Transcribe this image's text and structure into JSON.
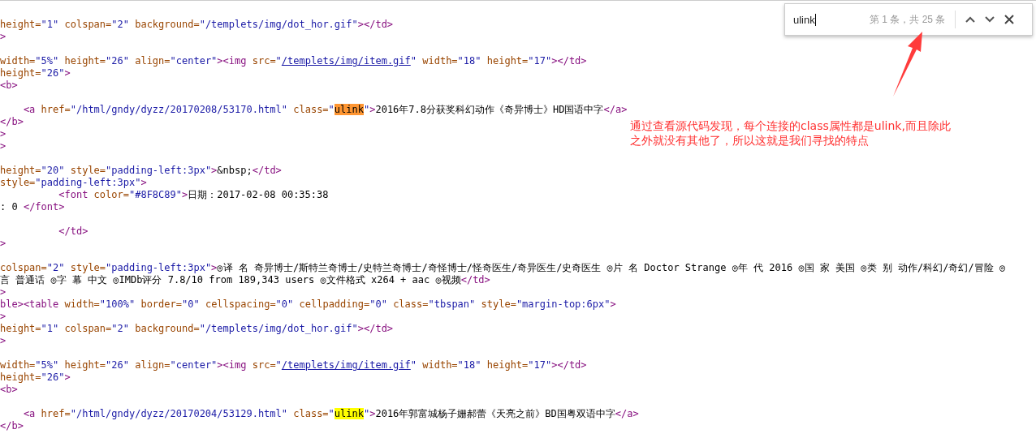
{
  "source_lines": [
    {
      "kind": "code",
      "segments": [
        {
          "kind": "attr",
          "text": "height="
        },
        {
          "kind": "value",
          "text": "\"1\" "
        },
        {
          "kind": "attr",
          "text": "colspan="
        },
        {
          "kind": "value",
          "text": "\"2\" "
        },
        {
          "kind": "attr",
          "text": "background="
        },
        {
          "kind": "value",
          "text": "\"/templets/img/dot_hor.gif\""
        },
        {
          "kind": "tag",
          "text": "></td>"
        }
      ]
    },
    {
      "kind": "code",
      "segments": [
        {
          "kind": "tag",
          "text": ">"
        }
      ]
    },
    {
      "kind": "blank"
    },
    {
      "kind": "code",
      "segments": [
        {
          "kind": "attr",
          "text": "width="
        },
        {
          "kind": "value",
          "text": "\"5%\" "
        },
        {
          "kind": "attr",
          "text": "height="
        },
        {
          "kind": "value",
          "text": "\"26\" "
        },
        {
          "kind": "attr",
          "text": "align="
        },
        {
          "kind": "value",
          "text": "\"center\""
        },
        {
          "kind": "tag",
          "text": "><img "
        },
        {
          "kind": "attr",
          "text": "src="
        },
        {
          "kind": "value",
          "text": "\""
        },
        {
          "kind": "link",
          "text": "/templets/img/item.gif"
        },
        {
          "kind": "value",
          "text": "\" "
        },
        {
          "kind": "attr",
          "text": "width="
        },
        {
          "kind": "value",
          "text": "\"18\" "
        },
        {
          "kind": "attr",
          "text": "height="
        },
        {
          "kind": "value",
          "text": "\"17\""
        },
        {
          "kind": "tag",
          "text": "></td>"
        }
      ]
    },
    {
      "kind": "code",
      "segments": [
        {
          "kind": "attr",
          "text": "height="
        },
        {
          "kind": "value",
          "text": "\"26\""
        },
        {
          "kind": "tag",
          "text": ">"
        }
      ]
    },
    {
      "kind": "code",
      "segments": [
        {
          "kind": "tag",
          "text": "<b>"
        }
      ]
    },
    {
      "kind": "blank"
    },
    {
      "kind": "code",
      "segments": [
        {
          "kind": "tag",
          "text": "    <a "
        },
        {
          "kind": "attr",
          "text": "href="
        },
        {
          "kind": "value",
          "text": "\"/html/gndy/dyzz/20170208/53170.html\" "
        },
        {
          "kind": "attr",
          "text": "class="
        },
        {
          "kind": "value",
          "text": "\""
        },
        {
          "kind": "match",
          "text": "ulink",
          "selected": true
        },
        {
          "kind": "value",
          "text": "\""
        },
        {
          "kind": "tag",
          "text": ">"
        },
        {
          "kind": "text",
          "text": "2016年7.8分获奖科幻动作《奇异博士》HD国语中字"
        },
        {
          "kind": "tag",
          "text": "</a>"
        }
      ]
    },
    {
      "kind": "code",
      "segments": [
        {
          "kind": "tag",
          "text": "</b>"
        }
      ]
    },
    {
      "kind": "code",
      "segments": [
        {
          "kind": "tag",
          "text": ">"
        }
      ]
    },
    {
      "kind": "code",
      "segments": [
        {
          "kind": "tag",
          "text": ">"
        }
      ]
    },
    {
      "kind": "blank"
    },
    {
      "kind": "code",
      "segments": [
        {
          "kind": "attr",
          "text": "height="
        },
        {
          "kind": "value",
          "text": "\"20\" "
        },
        {
          "kind": "attr",
          "text": "style="
        },
        {
          "kind": "value",
          "text": "\"padding-left:3px\""
        },
        {
          "kind": "tag",
          "text": ">"
        },
        {
          "kind": "text",
          "text": "&nbsp;"
        },
        {
          "kind": "tag",
          "text": "</td>"
        }
      ]
    },
    {
      "kind": "code",
      "segments": [
        {
          "kind": "attr",
          "text": "style="
        },
        {
          "kind": "value",
          "text": "\"padding-left:3px\""
        },
        {
          "kind": "tag",
          "text": ">"
        }
      ]
    },
    {
      "kind": "code",
      "segments": [
        {
          "kind": "tag",
          "text": "          <font "
        },
        {
          "kind": "attr",
          "text": "color="
        },
        {
          "kind": "value",
          "text": "\"#8F8C89\""
        },
        {
          "kind": "tag",
          "text": ">"
        },
        {
          "kind": "text",
          "text": "日期：2017-02-08 00:35:38"
        }
      ]
    },
    {
      "kind": "code",
      "segments": [
        {
          "kind": "text",
          "text": ": 0 "
        },
        {
          "kind": "tag",
          "text": "</font>"
        }
      ]
    },
    {
      "kind": "blank"
    },
    {
      "kind": "code",
      "segments": [
        {
          "kind": "tag",
          "text": "          </td>"
        }
      ]
    },
    {
      "kind": "code",
      "segments": [
        {
          "kind": "tag",
          "text": ">"
        }
      ]
    },
    {
      "kind": "blank"
    },
    {
      "kind": "code",
      "segments": [
        {
          "kind": "attr",
          "text": "colspan="
        },
        {
          "kind": "value",
          "text": "\"2\" "
        },
        {
          "kind": "attr",
          "text": "style="
        },
        {
          "kind": "value",
          "text": "\"padding-left:3px\""
        },
        {
          "kind": "tag",
          "text": ">"
        },
        {
          "kind": "text",
          "text": "◎译 名 奇异博士/斯特兰奇博士/史特兰奇博士/奇怪博士/怪奇医生/奇异医生/史奇医生 ◎片 名 Doctor Strange ◎年 代 2016 ◎国 家 美国 ◎类 别 动作/科幻/奇幻/冒险 ◎"
        }
      ]
    },
    {
      "kind": "code",
      "segments": [
        {
          "kind": "text",
          "text": "言 普通话 ◎字 幕 中文 ◎IMDb评分 7.8/10 from 189,343 users ◎文件格式 x264 + aac ◎视频"
        },
        {
          "kind": "tag",
          "text": "</td>"
        }
      ]
    },
    {
      "kind": "code",
      "segments": [
        {
          "kind": "tag",
          "text": ">"
        }
      ]
    },
    {
      "kind": "code",
      "segments": [
        {
          "kind": "tag",
          "text": "ble><table "
        },
        {
          "kind": "attr",
          "text": "width="
        },
        {
          "kind": "value",
          "text": "\"100%\" "
        },
        {
          "kind": "attr",
          "text": "border="
        },
        {
          "kind": "value",
          "text": "\"0\" "
        },
        {
          "kind": "attr",
          "text": "cellspacing="
        },
        {
          "kind": "value",
          "text": "\"0\" "
        },
        {
          "kind": "attr",
          "text": "cellpadding="
        },
        {
          "kind": "value",
          "text": "\"0\" "
        },
        {
          "kind": "attr",
          "text": "class="
        },
        {
          "kind": "value",
          "text": "\"tbspan\" "
        },
        {
          "kind": "attr",
          "text": "style="
        },
        {
          "kind": "value",
          "text": "\"margin-top:6px\""
        },
        {
          "kind": "tag",
          "text": ">"
        }
      ]
    },
    {
      "kind": "code",
      "segments": [
        {
          "kind": "tag",
          "text": ">"
        }
      ]
    },
    {
      "kind": "code",
      "segments": [
        {
          "kind": "attr",
          "text": "height="
        },
        {
          "kind": "value",
          "text": "\"1\" "
        },
        {
          "kind": "attr",
          "text": "colspan="
        },
        {
          "kind": "value",
          "text": "\"2\" "
        },
        {
          "kind": "attr",
          "text": "background="
        },
        {
          "kind": "value",
          "text": "\"/templets/img/dot_hor.gif\""
        },
        {
          "kind": "tag",
          "text": "></td>"
        }
      ]
    },
    {
      "kind": "code",
      "segments": [
        {
          "kind": "tag",
          "text": ">"
        }
      ]
    },
    {
      "kind": "blank"
    },
    {
      "kind": "code",
      "segments": [
        {
          "kind": "attr",
          "text": "width="
        },
        {
          "kind": "value",
          "text": "\"5%\" "
        },
        {
          "kind": "attr",
          "text": "height="
        },
        {
          "kind": "value",
          "text": "\"26\" "
        },
        {
          "kind": "attr",
          "text": "align="
        },
        {
          "kind": "value",
          "text": "\"center\""
        },
        {
          "kind": "tag",
          "text": "><img "
        },
        {
          "kind": "attr",
          "text": "src="
        },
        {
          "kind": "value",
          "text": "\""
        },
        {
          "kind": "link",
          "text": "/templets/img/item.gif"
        },
        {
          "kind": "value",
          "text": "\" "
        },
        {
          "kind": "attr",
          "text": "width="
        },
        {
          "kind": "value",
          "text": "\"18\" "
        },
        {
          "kind": "attr",
          "text": "height="
        },
        {
          "kind": "value",
          "text": "\"17\""
        },
        {
          "kind": "tag",
          "text": "></td>"
        }
      ]
    },
    {
      "kind": "code",
      "segments": [
        {
          "kind": "attr",
          "text": "height="
        },
        {
          "kind": "value",
          "text": "\"26\""
        },
        {
          "kind": "tag",
          "text": ">"
        }
      ]
    },
    {
      "kind": "code",
      "segments": [
        {
          "kind": "tag",
          "text": "<b>"
        }
      ]
    },
    {
      "kind": "blank"
    },
    {
      "kind": "code",
      "segments": [
        {
          "kind": "tag",
          "text": "    <a "
        },
        {
          "kind": "attr",
          "text": "href="
        },
        {
          "kind": "value",
          "text": "\"/html/gndy/dyzz/20170204/53129.html\" "
        },
        {
          "kind": "attr",
          "text": "class="
        },
        {
          "kind": "value",
          "text": "\""
        },
        {
          "kind": "match",
          "text": "ulink",
          "selected": false
        },
        {
          "kind": "value",
          "text": "\""
        },
        {
          "kind": "tag",
          "text": ">"
        },
        {
          "kind": "text",
          "text": "2016年郭富城杨子姗郝蕾《天亮之前》BD国粤双语中字"
        },
        {
          "kind": "tag",
          "text": "</a>"
        }
      ]
    },
    {
      "kind": "code",
      "segments": [
        {
          "kind": "tag",
          "text": "</b>"
        }
      ]
    }
  ],
  "find_bar": {
    "value": "ulink",
    "count": "第 1 条，共 25 条"
  },
  "annotation": {
    "text": "通过查看源代码发现，每个连接的class属性都是ulink,而且除此之外就没有其他了，所以这就是我们寻找的特点"
  }
}
